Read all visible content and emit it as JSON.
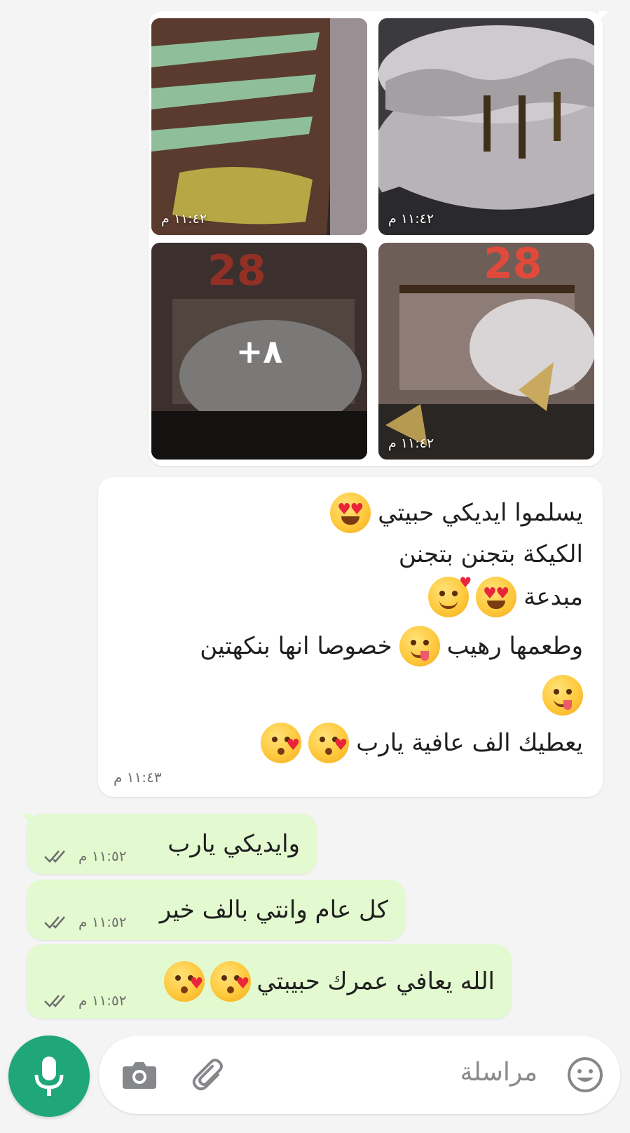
{
  "photos": [
    {
      "time": "١١:٤٢ م"
    },
    {
      "time": "١١:٤٢ م"
    },
    {
      "time": "١١:٤٢ م"
    },
    {
      "more": "+٨"
    }
  ],
  "incoming": {
    "lines": [
      "يسلموا ايديكي حبيتي",
      "الكيكة بتجنن بتجنن",
      "مبدعة",
      "وطعمها رهيب",
      "خصوصا انها بنكهتين",
      "يعطيك الف عافية يارب"
    ],
    "time": "١١:٤٣ م"
  },
  "outgoing": [
    {
      "text": "وايديكي يارب",
      "time": "١١:٥٢ م"
    },
    {
      "text": "كل عام وانتي بالف خير",
      "time": "١١:٥٢ م"
    },
    {
      "text": "الله يعافي عمرك حبيبتي",
      "time": "١١:٥٢ م"
    }
  ],
  "composer": {
    "placeholder": "مراسلة",
    "icons": [
      "emoji-icon",
      "attach-icon",
      "camera-icon",
      "mic-icon"
    ]
  },
  "colors": {
    "background": "#f4f4f5",
    "incoming_bubble": "#ffffff",
    "outgoing_bubble": "#e3fad0",
    "mic_button": "#1fa77a",
    "ticks": "#6e6e6e"
  }
}
